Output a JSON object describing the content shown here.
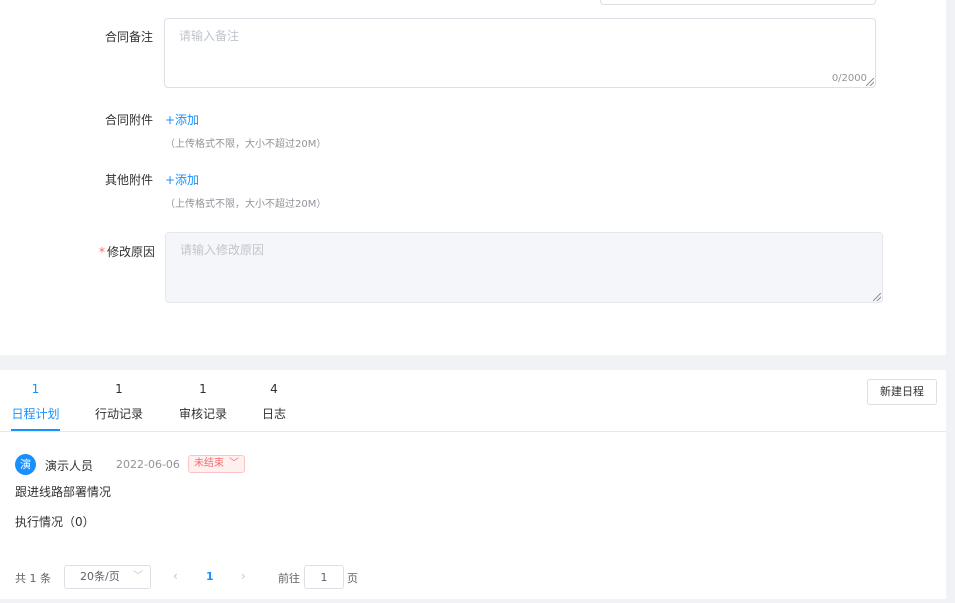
{
  "form": {
    "contract_remark": {
      "label": "合同备注",
      "placeholder": "请输入备注",
      "counter": "0/2000"
    },
    "contract_attachment": {
      "label": "合同附件",
      "add_label": "+添加",
      "hint": "（上传格式不限，大小不超过20M）"
    },
    "other_attachment": {
      "label": "其他附件",
      "add_label": "+添加",
      "hint": "（上传格式不限，大小不超过20M）"
    },
    "modify_reason": {
      "required_mark": "*",
      "label": "修改原因",
      "placeholder": "请输入修改原因"
    }
  },
  "tabs": [
    {
      "count": "1",
      "label": "日程计划",
      "active": true
    },
    {
      "count": "1",
      "label": "行动记录",
      "active": false
    },
    {
      "count": "1",
      "label": "审核记录",
      "active": false
    },
    {
      "count": "4",
      "label": "日志",
      "active": false
    }
  ],
  "new_schedule_button": "新建日程",
  "entry": {
    "avatar_text": "演",
    "person": "演示人员",
    "date": "2022-06-06",
    "status": "未结束",
    "content": "跟进线路部署情况",
    "execution_label": "执行情况（0）"
  },
  "pagination": {
    "total": "共 1 条",
    "page_size": "20条/页",
    "current_page": "1",
    "goto_label": "前往",
    "goto_value": "1",
    "page_suffix": "页"
  },
  "icons": {
    "prev": "chevron-left-icon",
    "next": "chevron-right-icon",
    "dropdown": "chevron-down-icon"
  },
  "colors": {
    "accent": "#1890ff",
    "danger": "#f56c6c"
  }
}
